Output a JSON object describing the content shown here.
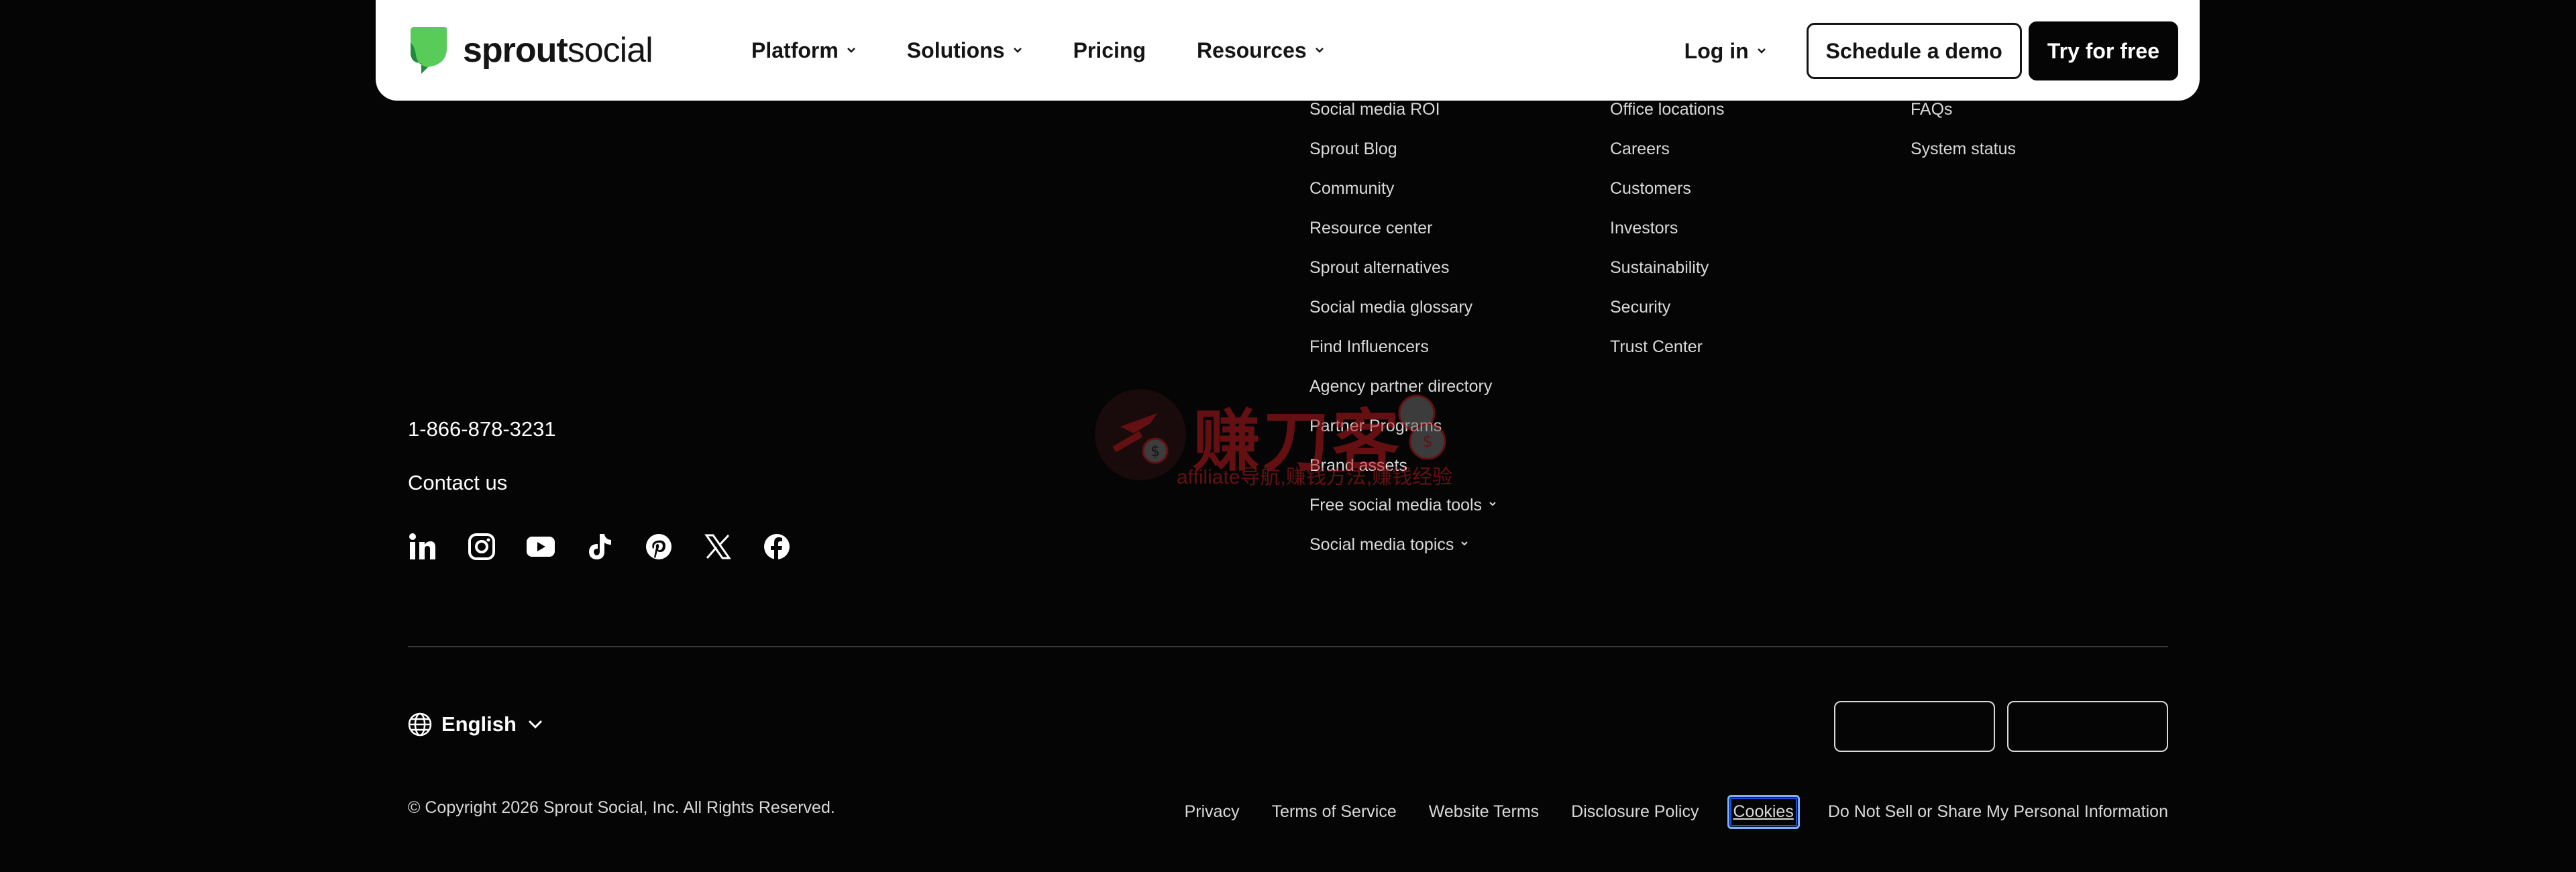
{
  "nav": {
    "logo_bold": "sprout",
    "logo_light": "social",
    "links": [
      "Platform",
      "Solutions",
      "Pricing",
      "Resources"
    ],
    "login": "Log in",
    "demo": "Schedule a demo",
    "try": "Try for free"
  },
  "footer": {
    "col1": [
      "Social media ROI",
      "Sprout Blog",
      "Community",
      "Resource center",
      "Sprout alternatives",
      "Social media glossary",
      "Find Influencers",
      "Agency partner directory",
      "Partner Programs",
      "Brand assets",
      "Free social media tools",
      "Social media topics"
    ],
    "col2": [
      "Office locations",
      "Careers",
      "Customers",
      "Investors",
      "Sustainability",
      "Security",
      "Trust Center"
    ],
    "col3": [
      "FAQs",
      "System status"
    ],
    "phone": "1-866-878-3231",
    "contact": "Contact us",
    "socials": [
      "linkedin-icon",
      "instagram-icon",
      "youtube-icon",
      "tiktok-icon",
      "pinterest-icon",
      "x-icon",
      "facebook-icon"
    ],
    "language": "English",
    "copyright": "© Copyright 2026 Sprout Social, Inc. All Rights Reserved.",
    "legal": [
      "Privacy",
      "Terms of Service",
      "Website Terms",
      "Disclosure Policy",
      "Cookies",
      "Do Not Sell or Share My Personal Information"
    ]
  },
  "watermark": {
    "big": "赚刀客",
    "small": "affiliate导航,赚钱方法,赚钱经验"
  },
  "colors": {
    "background": "#050505",
    "brand_green": "#59cb59",
    "text": "#ffffff",
    "focus": "#7fb0ff"
  }
}
